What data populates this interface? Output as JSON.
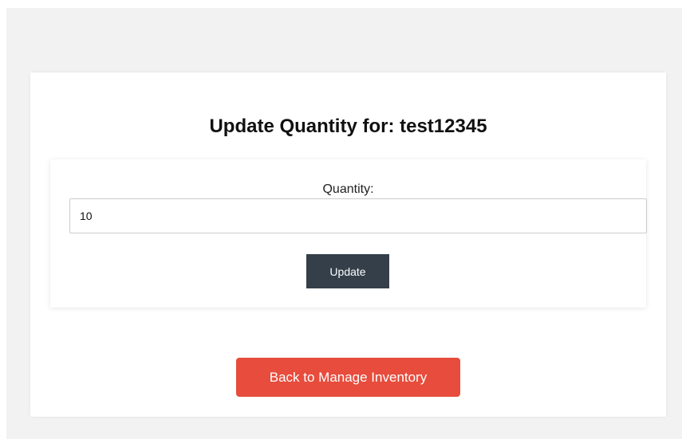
{
  "page": {
    "title": "Update Quantity for: test12345"
  },
  "form": {
    "quantity_label": "Quantity:",
    "quantity_value": "10",
    "update_label": "Update"
  },
  "navigation": {
    "back_label": "Back to Manage Inventory"
  },
  "colors": {
    "background": "#f2f2f2",
    "card": "#ffffff",
    "update_button": "#343f4a",
    "back_button": "#e74c3c"
  }
}
